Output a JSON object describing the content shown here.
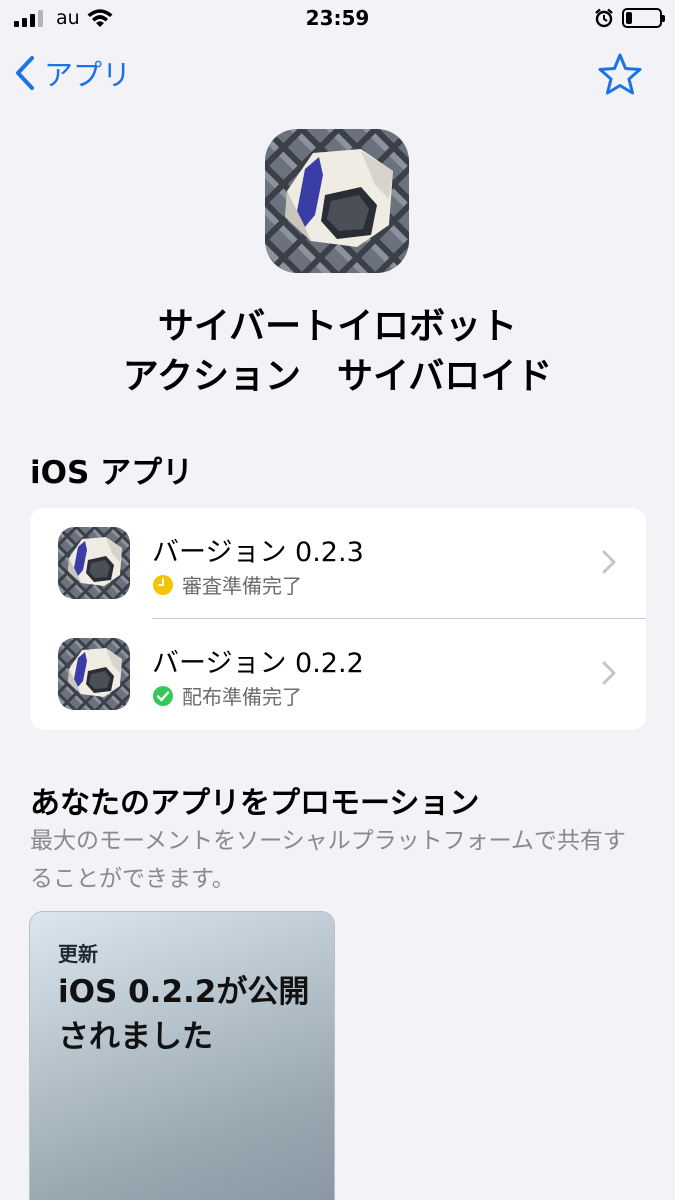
{
  "status_bar": {
    "carrier": "au",
    "time": "23:59",
    "battery_level": 0.2
  },
  "nav": {
    "back_label": "アプリ",
    "icons": {
      "back": "chevron-left-icon",
      "favorite": "star-icon"
    },
    "accent_color": "#1a73e8"
  },
  "app": {
    "title_line1": "サイバートイロボット",
    "title_line2": "アクション　サイバロイド"
  },
  "ios_section": {
    "title": "iOS アプリ",
    "versions": [
      {
        "label": "バージョン 0.2.3",
        "status": "審査準備完了",
        "status_icon": "clock-icon",
        "status_color": "#f5c400"
      },
      {
        "label": "バージョン 0.2.2",
        "status": "配布準備完了",
        "status_icon": "checkmark-circle-icon",
        "status_color": "#34c759"
      }
    ]
  },
  "promotion": {
    "title": "あなたのアプリをプロモーション",
    "description": "最大のモーメントをソーシャルプラットフォームで共有することができます。",
    "card": {
      "label": "更新",
      "headline": "iOS 0.2.2が公開されました"
    }
  }
}
